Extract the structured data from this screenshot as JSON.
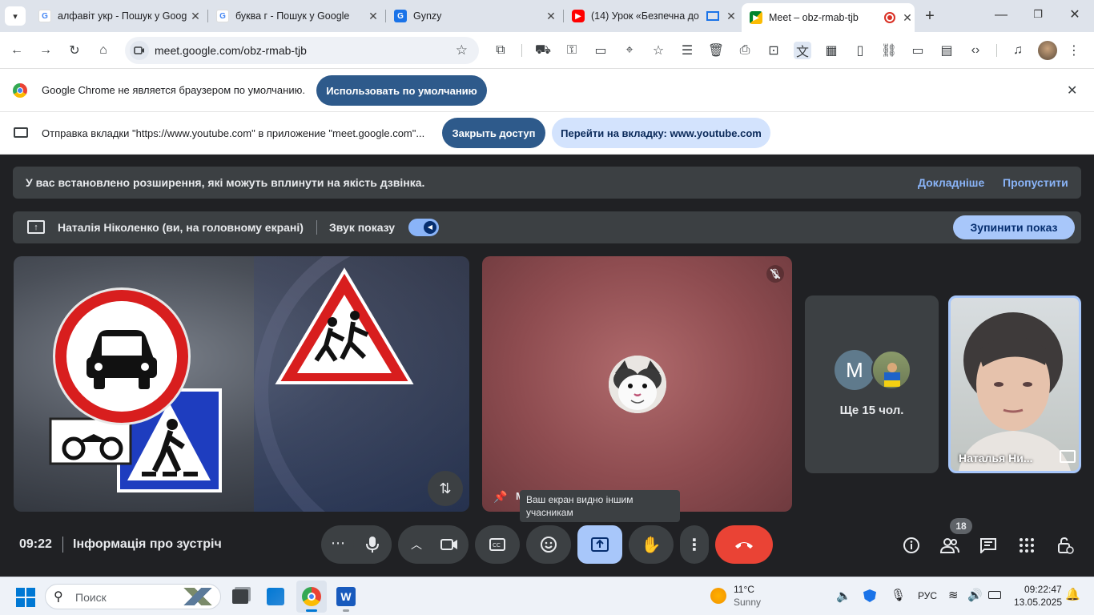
{
  "tabs": [
    {
      "title": "алфавіт укр - Пошук у Goog",
      "icon": "google-icon"
    },
    {
      "title": "буква г - Пошук у Google",
      "icon": "google-icon"
    },
    {
      "title": "Gynzy",
      "icon": "gynzy-icon"
    },
    {
      "title": "(14) Урок «Безпечна до",
      "icon": "youtube-icon"
    },
    {
      "title": "Meet – obz-rmab-tjb",
      "icon": "meet-icon"
    }
  ],
  "address_bar": {
    "url": "meet.google.com/obz-rmab-tjb"
  },
  "default_browser_bar": {
    "text": "Google Chrome не является браузером по умолчанию.",
    "button": "Использовать по умолчанию"
  },
  "tab_share_bar": {
    "text": "Отправка вкладки \"https://www.youtube.com\" в приложение \"meet.google.com\"...",
    "stop_button": "Закрыть доступ",
    "switch_button": "Перейти на вкладку: www.youtube.com"
  },
  "extension_warning": {
    "text": "У вас встановлено розширення, які можуть вплинути на якість дзвінка.",
    "learn_more": "Докладніше",
    "skip": "Пропустити"
  },
  "presentation_bar": {
    "presenter": "Наталія Ніколенко (ви, на головному екрані)",
    "sound_label": "Звук показу",
    "stop_button": "Зупинити показ"
  },
  "participants": {
    "more_avatar_letter": "M",
    "more_label": "Ще 15 чол.",
    "self_name": "Наталья Ни...",
    "count_badge": "18"
  },
  "tooltip": {
    "text": "Ваш екран видно іншим учасникам"
  },
  "bottom_bar": {
    "time": "09:22",
    "meeting_info": "Інформація про зустріч"
  },
  "taskbar": {
    "search_placeholder": "Поиск",
    "weather_temp": "11°C",
    "weather_desc": "Sunny",
    "language": "РУС",
    "clock_time": "09:22:47",
    "clock_date": "13.05.2025"
  },
  "colors": {
    "meet_bg": "#202124",
    "banner_bg": "#3c4043",
    "accent_blue": "#8ab4f8",
    "end_call_red": "#ea4335",
    "present_active": "#a8c7fa"
  }
}
